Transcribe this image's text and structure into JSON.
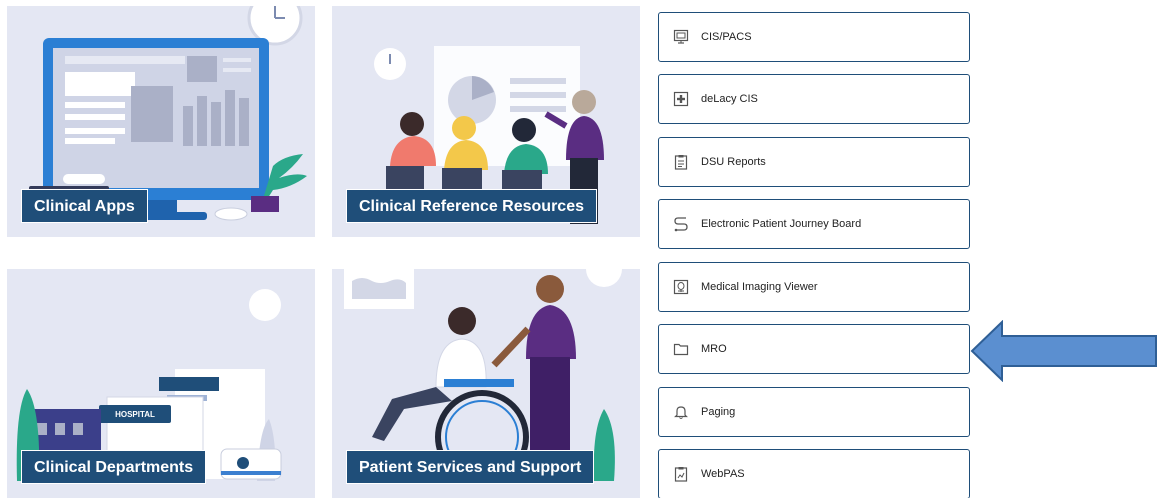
{
  "tiles": [
    {
      "label": "Clinical Apps"
    },
    {
      "label": "Clinical Reference Resources"
    },
    {
      "label": "Clinical Departments"
    },
    {
      "label": "Patient Services and Support"
    }
  ],
  "hospital_sign": "HOSPITAL",
  "apps": [
    {
      "label": "CIS/PACS",
      "icon": "monitor-icon"
    },
    {
      "label": "deLacy CIS",
      "icon": "medical-cross-icon"
    },
    {
      "label": "DSU Reports",
      "icon": "clipboard-icon"
    },
    {
      "label": "Electronic Patient Journey Board",
      "icon": "route-icon"
    },
    {
      "label": "Medical Imaging Viewer",
      "icon": "imaging-icon"
    },
    {
      "label": "MRO",
      "icon": "folder-icon"
    },
    {
      "label": "Paging",
      "icon": "bell-icon"
    },
    {
      "label": "WebPAS",
      "icon": "clipboard-chart-icon"
    }
  ],
  "colors": {
    "tile_bg": "#e4e7f3",
    "label_bg": "#1f4e79",
    "button_border": "#1f4e79",
    "arrow_fill": "#5b8fd0",
    "arrow_stroke": "#2f5f96"
  }
}
